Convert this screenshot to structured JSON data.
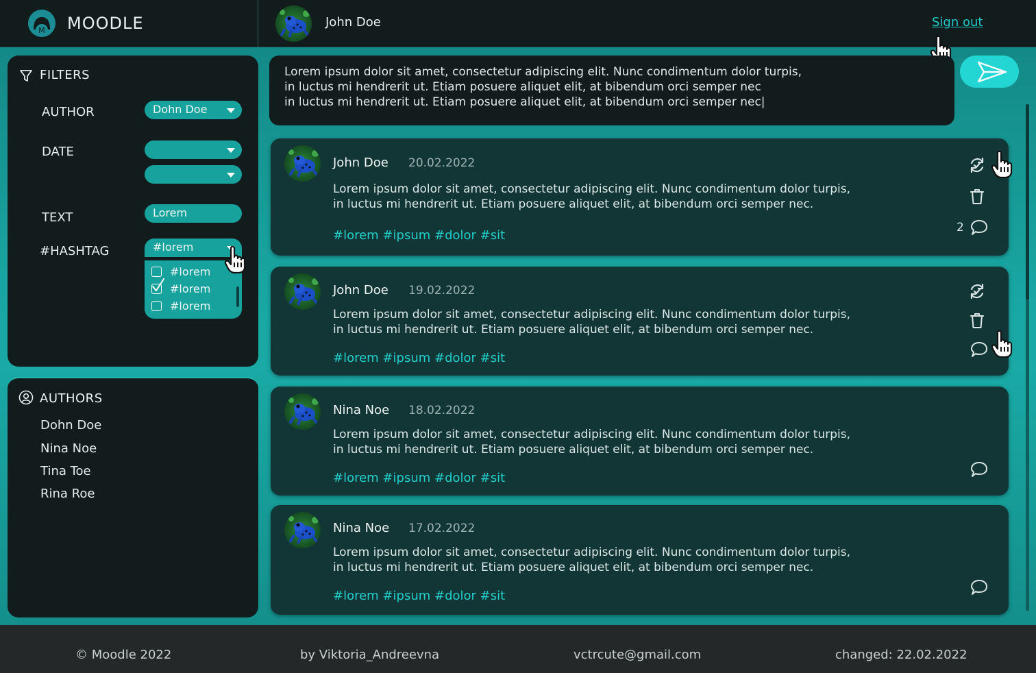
{
  "header": {
    "brand": "MOODLE",
    "user_name": "John Doe",
    "signout_label": "Sign out"
  },
  "filters": {
    "title": "FILTERS",
    "author_label": "AUTHOR",
    "author_value": "Dohn Doe",
    "date_label": "DATE",
    "date_from": "",
    "date_to": "",
    "text_label": "TEXT",
    "text_value": "Lorem",
    "hashtag_label": "#HASHTAG",
    "hashtag_value": "#lorem",
    "hashtag_options": [
      {
        "label": "#lorem",
        "checked": false
      },
      {
        "label": "#lorem",
        "checked": true
      },
      {
        "label": "#lorem",
        "checked": false
      }
    ]
  },
  "authors": {
    "title": "AUTHORS",
    "items": [
      "Dohn Doe",
      "Nina Noe",
      "Tina Toe",
      "Rina Roe"
    ]
  },
  "composer": {
    "text_line1": "Lorem ipsum dolor sit amet, consectetur adipiscing elit. Nunc condimentum dolor turpis,",
    "text_line2": "in luctus mi hendrerit ut. Etiam posuere aliquet elit, at bibendum orci semper nec",
    "text_line3": "in luctus mi hendrerit ut. Etiam posuere aliquet elit, at bibendum orci semper nec|"
  },
  "posts": [
    {
      "author": "John Doe",
      "date": "20.02.2022",
      "line1": "Lorem ipsum dolor sit amet, consectetur adipiscing elit. Nunc condimentum dolor turpis,",
      "line2": "in luctus mi hendrerit ut. Etiam posuere aliquet elit, at bibendum orci semper nec.",
      "tags": "#lorem #ipsum #dolor #sit",
      "comment_count": "2"
    },
    {
      "author": "John Doe",
      "date": "19.02.2022",
      "line1": "Lorem ipsum dolor sit amet, consectetur adipiscing elit. Nunc condimentum dolor turpis,",
      "line2": "in luctus mi hendrerit ut. Etiam posuere aliquet elit, at bibendum orci semper nec.",
      "tags": "#lorem #ipsum #dolor #sit"
    },
    {
      "author": "Nina Noe",
      "date": "18.02.2022",
      "line1": "Lorem ipsum dolor sit amet, consectetur adipiscing elit. Nunc condimentum dolor turpis,",
      "line2": "in luctus mi hendrerit ut. Etiam posuere aliquet elit, at bibendum orci semper nec.",
      "tags": "#lorem #ipsum #dolor #sit"
    },
    {
      "author": "Nina Noe",
      "date": "17.02.2022",
      "line1": "Lorem ipsum dolor sit amet, consectetur adipiscing elit. Nunc condimentum dolor turpis,",
      "line2": "in luctus mi hendrerit ut. Etiam posuere aliquet elit, at bibendum orci semper nec.",
      "tags": "#lorem #ipsum #dolor #sit"
    }
  ],
  "footer": {
    "copyright": "© Moodle 2022",
    "by": "by Viktoria_Andreevna",
    "email": "vctrcute@gmail.com",
    "changed": "changed: 22.02.2022"
  },
  "colors": {
    "accent": "#21cfcb",
    "panel": "#121c1d",
    "post_bg": "#123636",
    "select_bg": "#18a29e"
  }
}
